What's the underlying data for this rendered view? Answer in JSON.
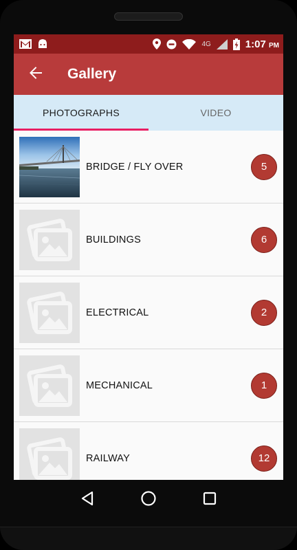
{
  "status_bar": {
    "network_label": "4G",
    "time": "1:07",
    "time_suffix": "PM",
    "icons": [
      "gmail-icon",
      "android-icon",
      "location-icon",
      "do-not-disturb-icon",
      "wifi-icon",
      "cell-signal-icon",
      "battery-charging-icon"
    ]
  },
  "app_bar": {
    "title": "Gallery",
    "back_icon": "arrow-back-icon",
    "background": "#b83b3b"
  },
  "tabs": [
    {
      "label": "PHOTOGRAPHS",
      "active": true
    },
    {
      "label": "VIDEO",
      "active": false
    }
  ],
  "tab_indicator_color": "#e91e63",
  "gallery": {
    "items": [
      {
        "label": "BRIDGE / FLY OVER",
        "count": "5",
        "thumbnail": "bridge-photo"
      },
      {
        "label": "BUILDINGS",
        "count": "6",
        "thumbnail": "placeholder-image-icon"
      },
      {
        "label": "ELECTRICAL",
        "count": "2",
        "thumbnail": "placeholder-image-icon"
      },
      {
        "label": "MECHANICAL",
        "count": "1",
        "thumbnail": "placeholder-image-icon"
      },
      {
        "label": "RAILWAY",
        "count": "12",
        "thumbnail": "placeholder-image-icon"
      }
    ],
    "badge_color": "#b23a32"
  },
  "nav_bar": {
    "icons": [
      "back-triangle-icon",
      "home-circle-icon",
      "recents-square-icon"
    ]
  }
}
